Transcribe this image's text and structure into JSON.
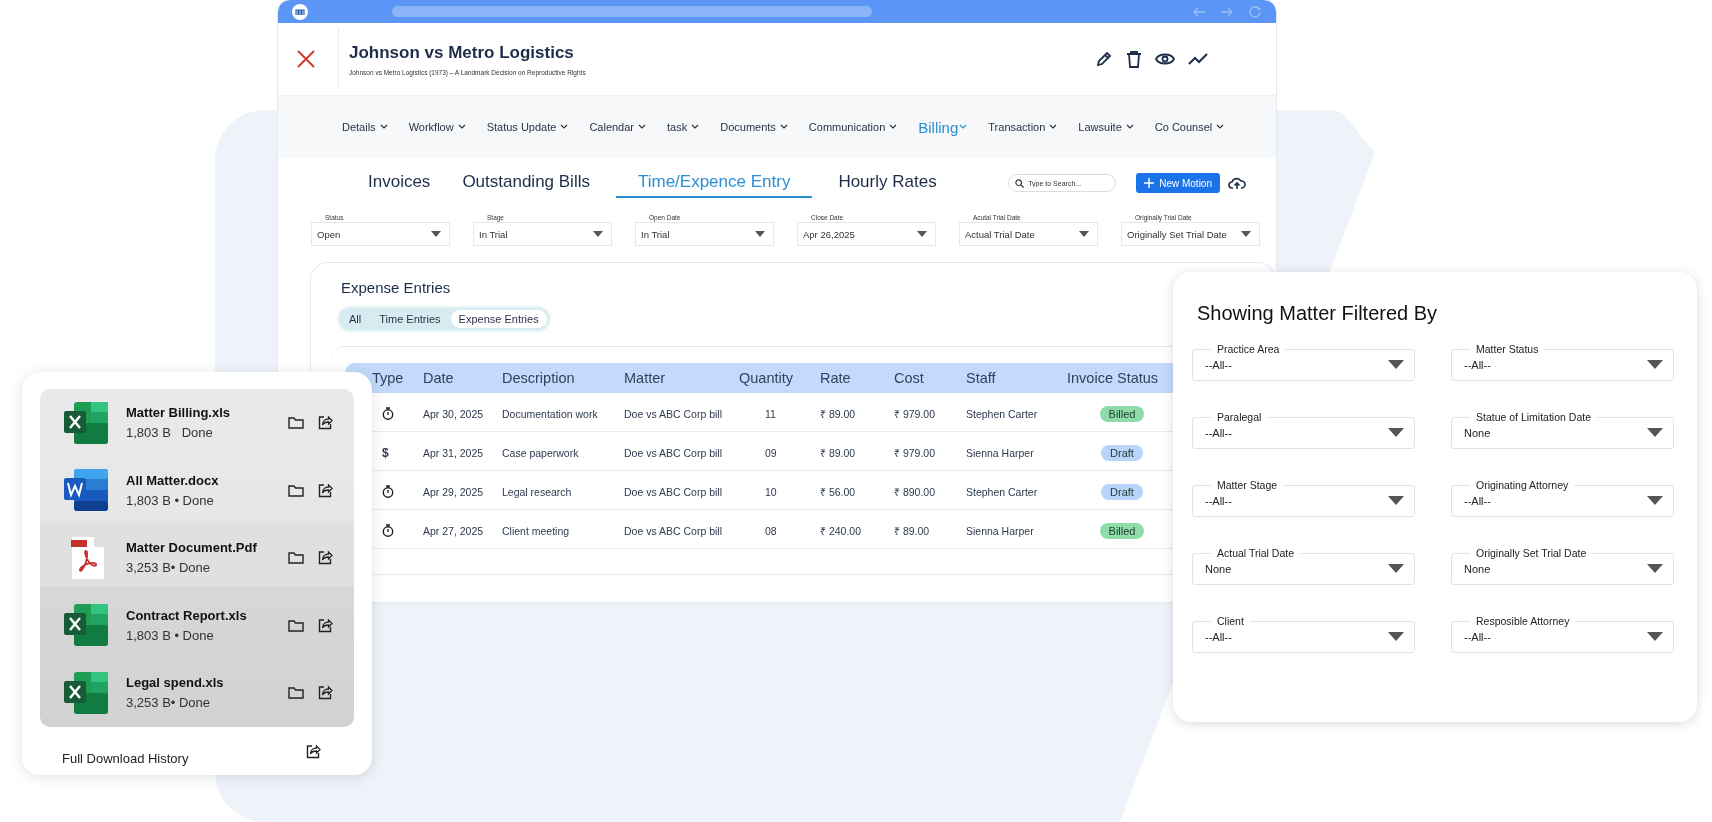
{
  "matter": {
    "title": "Johnson vs Metro Logistics",
    "subtitle": "Johnson vs Metro Logistics (1973) – A Landmark Decision on Reproductive Rights"
  },
  "nav": [
    {
      "label": "Details",
      "selected": false
    },
    {
      "label": "Workflow",
      "selected": false
    },
    {
      "label": "Status Update",
      "selected": false
    },
    {
      "label": "Calendar",
      "selected": false
    },
    {
      "label": "task",
      "selected": false
    },
    {
      "label": "Documents",
      "selected": false
    },
    {
      "label": "Communication",
      "selected": false
    },
    {
      "label": "Billing",
      "selected": true
    },
    {
      "label": "Transaction",
      "selected": false
    },
    {
      "label": "Lawsuite",
      "selected": false
    },
    {
      "label": "Co Counsel",
      "selected": false
    }
  ],
  "tabs": [
    {
      "label": "Invoices",
      "selected": false
    },
    {
      "label": "Outstanding Bills",
      "selected": false
    },
    {
      "label": "Time/Expence Entry",
      "selected": true
    },
    {
      "label": "Hourly Rates",
      "selected": false
    }
  ],
  "search": {
    "placeholder": "Type to Search..."
  },
  "new_button": {
    "label": "New Motion"
  },
  "filters": [
    {
      "label": "Status",
      "value": "Open"
    },
    {
      "label": "Stage",
      "value": "In Trial"
    },
    {
      "label": "Open Date",
      "value": "In Trial"
    },
    {
      "label": "Close Date",
      "value": "Apr 26,2025"
    },
    {
      "label": "Acutal Trial Date",
      "value": "Actual Trial Date"
    },
    {
      "label": "Originally Trial Date",
      "value": "Originally Set Trial Date"
    }
  ],
  "expense": {
    "title": "Expense Entries",
    "segments": [
      {
        "label": "All",
        "selected": false
      },
      {
        "label": "Time Entries",
        "selected": false
      },
      {
        "label": "Expense Entries",
        "selected": true
      }
    ],
    "columns": [
      "Type",
      "Date",
      "Description",
      "Matter",
      "Quantity",
      "Rate",
      "Cost",
      "Staff",
      "Invoice Status"
    ],
    "rows": [
      {
        "kind": "time",
        "date": "Apr 30, 2025",
        "description": "Documentation work",
        "matter": "Doe vs ABC Corp bill",
        "quantity": "11",
        "rate": "₹ 89.00",
        "cost": "₹ 979.00",
        "staff": "Stephen Carter",
        "status": {
          "label": "Billed",
          "color": "#8fdcaa"
        }
      },
      {
        "kind": "expense",
        "type_text": "$",
        "date": "Apr 31, 2025",
        "description": "Case paperwork",
        "matter": "Doe vs ABC Corp bill",
        "quantity": "09",
        "rate": "₹ 89.00",
        "cost": "₹ 979.00",
        "staff": "Sienna Harper",
        "status": {
          "label": "Draft",
          "color": "#b9d4fa"
        }
      },
      {
        "kind": "time",
        "date": "Apr 29, 2025",
        "description": "Legal research",
        "matter": "Doe vs ABC Corp bill",
        "quantity": "10",
        "rate": "₹ 56.00",
        "cost": "₹ 890.00",
        "staff": "Stephen Carter",
        "status": {
          "label": "Draft",
          "color": "#b9d4fa"
        }
      },
      {
        "kind": "time",
        "date": "Apr 27, 2025",
        "description": "Client meeting",
        "matter": "Doe vs ABC Corp bill",
        "quantity": "08",
        "rate": "₹ 240.00",
        "cost": "₹ 89.00",
        "staff": "Sienna Harper",
        "status": {
          "label": "Billed",
          "color": "#8fdcaa"
        }
      }
    ]
  },
  "downloads": {
    "items": [
      {
        "kind": "excel",
        "name": "Matter Billing.xls",
        "meta": "1,803 B   Done"
      },
      {
        "kind": "word",
        "name": "All Matter.docx",
        "meta": "1,803 B • Done"
      },
      {
        "kind": "pdf",
        "name": "Matter Document.Pdf",
        "meta": "3,253 B• Done"
      },
      {
        "kind": "excel",
        "name": "Contract Report.xls",
        "meta": "1,803 B • Done"
      },
      {
        "kind": "excel",
        "name": "Legal spend.xls",
        "meta": "3,253 B• Done"
      }
    ],
    "footer": "Full Download History"
  },
  "filter_panel": {
    "title": "Showing Matter Filtered By",
    "fields": [
      {
        "label": "Practice Area",
        "value": "--All--"
      },
      {
        "label": "Matter Status",
        "value": "--All--"
      },
      {
        "label": "Paralegal",
        "value": "--All--"
      },
      {
        "label": "Statue of Limitation Date",
        "value": "None"
      },
      {
        "label": "Matter Stage",
        "value": "--All--"
      },
      {
        "label": "Originating Attorney",
        "value": "--All--"
      },
      {
        "label": "Actual Trial Date",
        "value": "None"
      },
      {
        "label": "Originally Set Trial Date",
        "value": "None"
      },
      {
        "label": "Client",
        "value": "--All--"
      },
      {
        "label": "Resposible Attorney",
        "value": "--All--"
      }
    ]
  }
}
